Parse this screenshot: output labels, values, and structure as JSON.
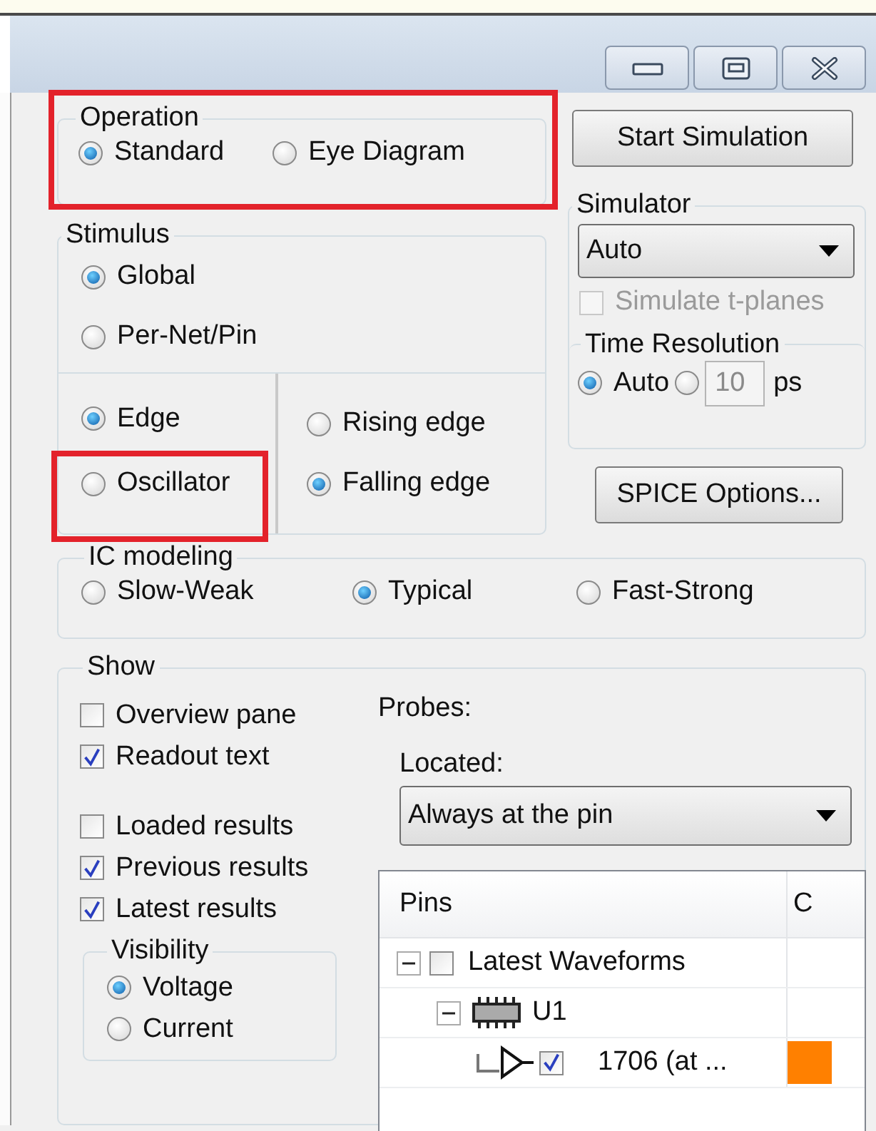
{
  "operation": {
    "title": "Operation",
    "highlighted": true,
    "options": [
      {
        "label": "Standard",
        "selected": true
      },
      {
        "label": "Eye Diagram",
        "selected": false
      }
    ]
  },
  "start_button": "Start Simulation",
  "stimulus": {
    "title": "Stimulus",
    "scope": [
      {
        "label": "Global",
        "selected": true
      },
      {
        "label": "Per-Net/Pin",
        "selected": false
      }
    ],
    "type": [
      {
        "label": "Edge",
        "selected": true,
        "highlighted": false
      },
      {
        "label": "Oscillator",
        "selected": false,
        "highlighted": true
      }
    ],
    "edge": [
      {
        "label": "Rising edge",
        "selected": false
      },
      {
        "label": "Falling edge",
        "selected": true
      }
    ]
  },
  "simulator": {
    "title": "Simulator",
    "engine": "Auto",
    "t_planes": {
      "label": "Simulate t-planes",
      "checked": false,
      "disabled": true
    },
    "time_resolution": {
      "title": "Time Resolution",
      "auto_label": "Auto",
      "auto_selected": true,
      "value": "10",
      "unit": "ps"
    }
  },
  "spice_button": "SPICE Options...",
  "ic_modeling": {
    "title": "IC modeling",
    "options": [
      {
        "label": "Slow-Weak",
        "selected": false
      },
      {
        "label": "Typical",
        "selected": true
      },
      {
        "label": "Fast-Strong",
        "selected": false
      }
    ]
  },
  "show": {
    "title": "Show",
    "display": [
      {
        "label": "Overview pane",
        "checked": false
      },
      {
        "label": "Readout text",
        "checked": true
      }
    ],
    "results": [
      {
        "label": "Loaded results",
        "checked": false
      },
      {
        "label": "Previous results",
        "checked": true
      },
      {
        "label": "Latest results",
        "checked": true
      }
    ],
    "visibility": {
      "title": "Visibility",
      "options": [
        {
          "label": "Voltage",
          "selected": true
        },
        {
          "label": "Current",
          "selected": false
        }
      ]
    },
    "probes_label": "Probes:",
    "located_label": "Located:",
    "located": "Always at the pin",
    "tree": {
      "columns": [
        "Pins",
        "C"
      ],
      "nodes": [
        {
          "label": "Latest Waveforms",
          "kind": "group",
          "checked": false,
          "expanded": true,
          "children": [
            {
              "label": "U1",
              "kind": "component",
              "expanded": true,
              "children": [
                {
                  "label": "1706 (at ...",
                  "kind": "pin",
                  "checked": true,
                  "color": "#ff8000"
                }
              ]
            }
          ]
        }
      ]
    }
  }
}
